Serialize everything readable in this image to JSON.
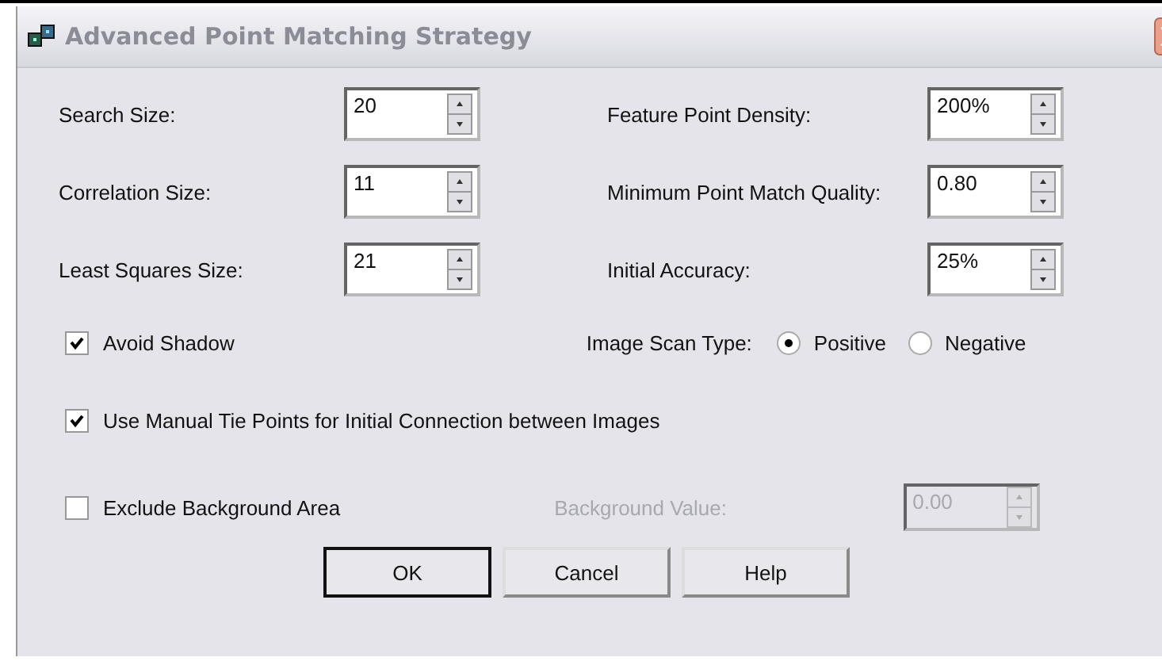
{
  "window": {
    "title": "Advanced Point Matching Strategy",
    "active": false
  },
  "left_fields": [
    {
      "label": "Search Size:",
      "value": "20"
    },
    {
      "label": "Correlation Size:",
      "value": "11"
    },
    {
      "label": "Least Squares Size:",
      "value": "21"
    }
  ],
  "right_fields": [
    {
      "label": "Feature Point Density:",
      "value": "200%"
    },
    {
      "label": "Minimum Point Match Quality:",
      "value": "0.80"
    },
    {
      "label": "Initial Accuracy:",
      "value": "25%"
    }
  ],
  "avoid_shadow": {
    "label": "Avoid Shadow",
    "checked": true
  },
  "image_scan_type": {
    "label": "Image Scan Type:",
    "options": [
      {
        "label": "Positive",
        "selected": true
      },
      {
        "label": "Negative",
        "selected": false
      }
    ]
  },
  "use_manual_tie_points": {
    "label": "Use Manual Tie Points for Initial Connection between Images",
    "checked": true
  },
  "exclude_background": {
    "label": "Exclude Background Area",
    "checked": false
  },
  "background_value": {
    "label": "Background Value:",
    "value": "0.00",
    "disabled": true
  },
  "buttons": [
    {
      "label": "OK",
      "default": true
    },
    {
      "label": "Cancel",
      "default": false
    },
    {
      "label": "Help",
      "default": false
    }
  ]
}
